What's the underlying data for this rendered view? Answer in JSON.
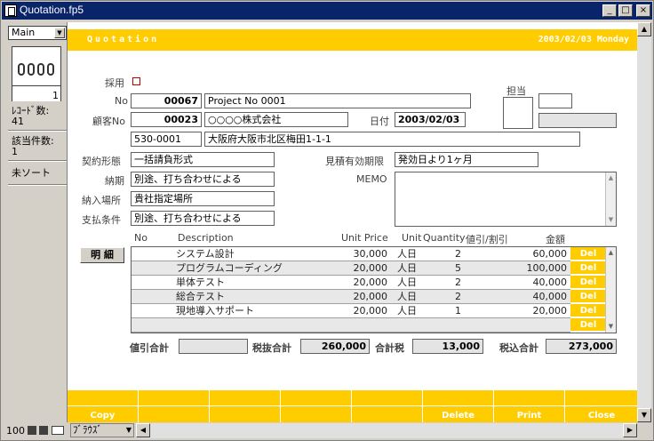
{
  "window": {
    "title": "Quotation.fp5",
    "minimize": "_",
    "maximize": "□",
    "close": "×"
  },
  "sidebar": {
    "layout": "Main",
    "page_number": "1",
    "record_count_label": "ﾚｺｰﾄﾞ数:",
    "record_count": "41",
    "found_label": "該当件数:",
    "found_count": "1",
    "sort_status": "未ソート"
  },
  "header": {
    "title": "Quotation",
    "date": "2003/02/03 Monday"
  },
  "form": {
    "adopt_label": "採用",
    "no_label": "No",
    "no_value": "00067",
    "project": "Project No 0001",
    "customer_label": "顧客No",
    "customer_no": "00023",
    "customer_name": "○○○○株式会社",
    "date_label": "日付",
    "date_value": "2003/02/03",
    "zip": "530-0001",
    "address": "大阪府大阪市北区梅田1-1-1",
    "contract_label": "契約形態",
    "contract_value": "一括請負形式",
    "validity_label": "見積有効期限",
    "validity_value": "発効日より1ヶ月",
    "delivery_label": "納期",
    "delivery_value": "別途、打ち合わせによる",
    "memo_label": "MEMO",
    "place_label": "納入場所",
    "place_value": "貴社指定場所",
    "payment_label": "支払条件",
    "payment_value": "別途、打ち合わせによる",
    "staff_label": "担当"
  },
  "lines": {
    "details_button": "明 細",
    "headers": {
      "no": "No",
      "description": "Description",
      "unit_price": "Unit Price",
      "unit": "Unit",
      "quantity": "Quantity",
      "discount": "値引/割引",
      "amount": "金額"
    },
    "delete_label": "Del",
    "rows": [
      {
        "description": "システム設計",
        "unit_price": "30,000",
        "unit": "人日",
        "quantity": "2",
        "amount": "60,000"
      },
      {
        "description": "プログラムコーディング",
        "unit_price": "20,000",
        "unit": "人日",
        "quantity": "5",
        "amount": "100,000"
      },
      {
        "description": "単体テスト",
        "unit_price": "20,000",
        "unit": "人日",
        "quantity": "2",
        "amount": "40,000"
      },
      {
        "description": "総合テスト",
        "unit_price": "20,000",
        "unit": "人日",
        "quantity": "2",
        "amount": "40,000"
      },
      {
        "description": "現地導入サポート",
        "unit_price": "20,000",
        "unit": "人日",
        "quantity": "1",
        "amount": "20,000"
      }
    ]
  },
  "totals": {
    "discount_label": "値引合計",
    "discount_value": "",
    "subtotal_label": "税抜合計",
    "subtotal_value": "260,000",
    "tax_label": "合計税",
    "tax_value": "13,000",
    "total_label": "税込合計",
    "total_value": "273,000"
  },
  "footer": {
    "copy": "Copy",
    "delete": "Delete",
    "print": "Print",
    "close": "Close"
  },
  "status": {
    "zoom": "100",
    "mode": "ﾌﾞﾗｳｽﾞ"
  },
  "colors": {
    "accent": "#ffcc00",
    "titlebar": "#0a246a"
  }
}
